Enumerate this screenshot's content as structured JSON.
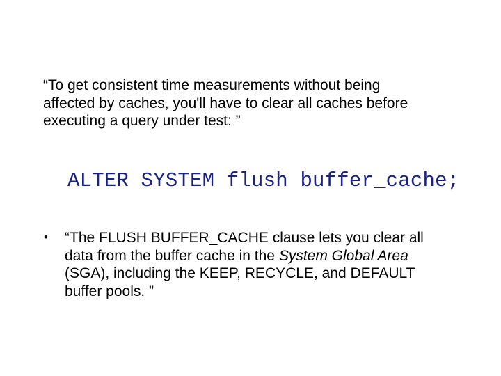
{
  "intro_quote": "“To get consistent time measurements without being affected by caches, you'll have to clear all caches before executing a query under test: ”",
  "code": {
    "text": "ALTER SYSTEM flush buffer_cache;"
  },
  "bullet": {
    "marker": "•",
    "text_before_italic": "“The FLUSH BUFFER_CACHE clause lets you clear all data from the buffer cache in the ",
    "italic_text": "System Global Area",
    "text_after_italic": " (SGA), including the KEEP, RECYCLE, and DEFAULT buffer pools. ”"
  }
}
